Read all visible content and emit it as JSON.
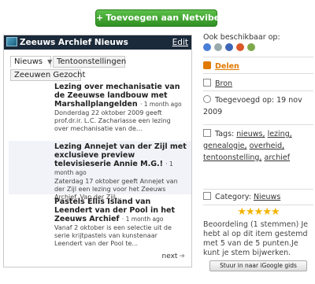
{
  "add_button": {
    "label": "Toevoegen aan Netvibes"
  },
  "widget": {
    "title": "Zeeuws Archief Nieuws",
    "edit_label": "Edit",
    "tabs": [
      {
        "label": "Nieuws",
        "active": true
      },
      {
        "label": "Tentoonstellingen"
      },
      {
        "label": "Zeeuwen Gezocht"
      }
    ],
    "items": [
      {
        "title": "Lezing over mechanisatie van de Zeeuwse landbouw met Marshallplangelden",
        "age": "· 1 month ago",
        "desc": "Donderdag 22 oktober 2009 geeft prof.dr.ir. L.C. Zachariasse een lezing over mechanisatie van de..."
      },
      {
        "title": "Lezing Annejet van der Zijl met exclusieve preview televisieserie Annie M.G.!",
        "age": "· 1 month ago",
        "desc": "Zaterdag 17 oktober geeft Annejet van der Zijl een lezing voor het Zeeuws Archief. Van der Zijl..."
      },
      {
        "title": "Pastels Ellis Island van Leendert van der Pool in het Zeeuws Archief",
        "age": "· 1 month ago",
        "desc": "Vanaf 2 oktober is een selectie uit de serie krijtpastels van kunstenaar Leendert van der Pool te..."
      }
    ],
    "next_label": "next"
  },
  "side": {
    "available_label": "Ook beschikbaar op:",
    "share_label": "Delen",
    "source_label": "Bron",
    "added_label": "Toegevoegd op: 19 nov 2009",
    "tags_label": "Tags:",
    "tags": [
      "nieuws,",
      "lezing,",
      "genealogie,",
      "overheid,",
      "tentoonstelling,",
      "archief"
    ],
    "category_label": "Category:",
    "category_value": "Nieuws",
    "stars": "★★★★★",
    "rating_text": "Beoordeling (1 stemmen) Je hebt al op dit item gestemd met 5 van de 5 punten.Je kunt je stem bijwerken.",
    "google_button": "Stuur in naar iGoogle gids"
  },
  "colors": {
    "green": "#3aa62b",
    "orange": "#e07a00",
    "titlebar": "#1b2a3a",
    "star": "#f2b400"
  }
}
